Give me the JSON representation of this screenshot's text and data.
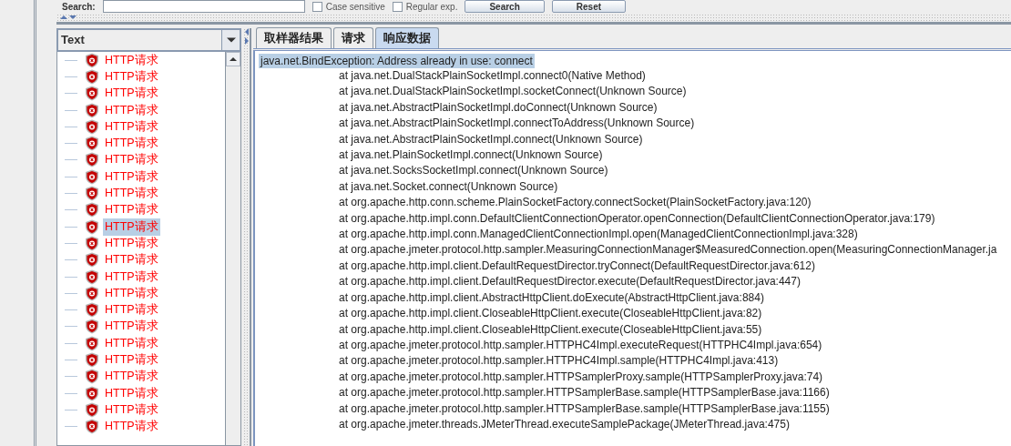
{
  "search_bar": {
    "label": "Search:",
    "options": [
      {
        "label": "Case sensitive",
        "checked": false
      },
      {
        "label": "Regular exp.",
        "checked": false
      }
    ],
    "buttons": [
      "Search",
      "Reset"
    ]
  },
  "renderer": {
    "value": "Text"
  },
  "tree": {
    "items": [
      {
        "label": "HTTP请求",
        "selected": false,
        "error": true
      },
      {
        "label": "HTTP请求",
        "selected": false,
        "error": true
      },
      {
        "label": "HTTP请求",
        "selected": false,
        "error": true
      },
      {
        "label": "HTTP请求",
        "selected": false,
        "error": true
      },
      {
        "label": "HTTP请求",
        "selected": false,
        "error": true
      },
      {
        "label": "HTTP请求",
        "selected": false,
        "error": true
      },
      {
        "label": "HTTP请求",
        "selected": false,
        "error": true
      },
      {
        "label": "HTTP请求",
        "selected": false,
        "error": true
      },
      {
        "label": "HTTP请求",
        "selected": false,
        "error": true
      },
      {
        "label": "HTTP请求",
        "selected": false,
        "error": true
      },
      {
        "label": "HTTP请求",
        "selected": true,
        "error": true
      },
      {
        "label": "HTTP请求",
        "selected": false,
        "error": true
      },
      {
        "label": "HTTP请求",
        "selected": false,
        "error": true
      },
      {
        "label": "HTTP请求",
        "selected": false,
        "error": true
      },
      {
        "label": "HTTP请求",
        "selected": false,
        "error": true
      },
      {
        "label": "HTTP请求",
        "selected": false,
        "error": true
      },
      {
        "label": "HTTP请求",
        "selected": false,
        "error": true
      },
      {
        "label": "HTTP请求",
        "selected": false,
        "error": true
      },
      {
        "label": "HTTP请求",
        "selected": false,
        "error": true
      },
      {
        "label": "HTTP请求",
        "selected": false,
        "error": true
      },
      {
        "label": "HTTP请求",
        "selected": false,
        "error": true
      },
      {
        "label": "HTTP请求",
        "selected": false,
        "error": true
      },
      {
        "label": "HTTP请求",
        "selected": false,
        "error": true
      }
    ]
  },
  "tabs": [
    {
      "label": "取样器结果",
      "selected": false
    },
    {
      "label": "请求",
      "selected": false
    },
    {
      "label": "响应数据",
      "selected": true
    }
  ],
  "response": {
    "headline": "java.net.BindException: Address already in use: connect",
    "headline_selected": true,
    "trace": [
      "at java.net.DualStackPlainSocketImpl.connect0(Native Method)",
      "at java.net.DualStackPlainSocketImpl.socketConnect(Unknown Source)",
      "at java.net.AbstractPlainSocketImpl.doConnect(Unknown Source)",
      "at java.net.AbstractPlainSocketImpl.connectToAddress(Unknown Source)",
      "at java.net.AbstractPlainSocketImpl.connect(Unknown Source)",
      "at java.net.PlainSocketImpl.connect(Unknown Source)",
      "at java.net.SocksSocketImpl.connect(Unknown Source)",
      "at java.net.Socket.connect(Unknown Source)",
      "at org.apache.http.conn.scheme.PlainSocketFactory.connectSocket(PlainSocketFactory.java:120)",
      "at org.apache.http.impl.conn.DefaultClientConnectionOperator.openConnection(DefaultClientConnectionOperator.java:179)",
      "at org.apache.http.impl.conn.ManagedClientConnectionImpl.open(ManagedClientConnectionImpl.java:328)",
      "at org.apache.jmeter.protocol.http.sampler.MeasuringConnectionManager$MeasuredConnection.open(MeasuringConnectionManager.ja",
      "at org.apache.http.impl.client.DefaultRequestDirector.tryConnect(DefaultRequestDirector.java:612)",
      "at org.apache.http.impl.client.DefaultRequestDirector.execute(DefaultRequestDirector.java:447)",
      "at org.apache.http.impl.client.AbstractHttpClient.doExecute(AbstractHttpClient.java:884)",
      "at org.apache.http.impl.client.CloseableHttpClient.execute(CloseableHttpClient.java:82)",
      "at org.apache.http.impl.client.CloseableHttpClient.execute(CloseableHttpClient.java:55)",
      "at org.apache.jmeter.protocol.http.sampler.HTTPHC4Impl.executeRequest(HTTPHC4Impl.java:654)",
      "at org.apache.jmeter.protocol.http.sampler.HTTPHC4Impl.sample(HTTPHC4Impl.java:413)",
      "at org.apache.jmeter.protocol.http.sampler.HTTPSamplerProxy.sample(HTTPSamplerProxy.java:74)",
      "at org.apache.jmeter.protocol.http.sampler.HTTPSamplerBase.sample(HTTPSamplerBase.java:1166)",
      "at org.apache.jmeter.protocol.http.sampler.HTTPSamplerBase.sample(HTTPSamplerBase.java:1155)",
      "at org.apache.jmeter.threads.JMeterThread.executeSamplePackage(JMeterThread.java:475)"
    ]
  }
}
